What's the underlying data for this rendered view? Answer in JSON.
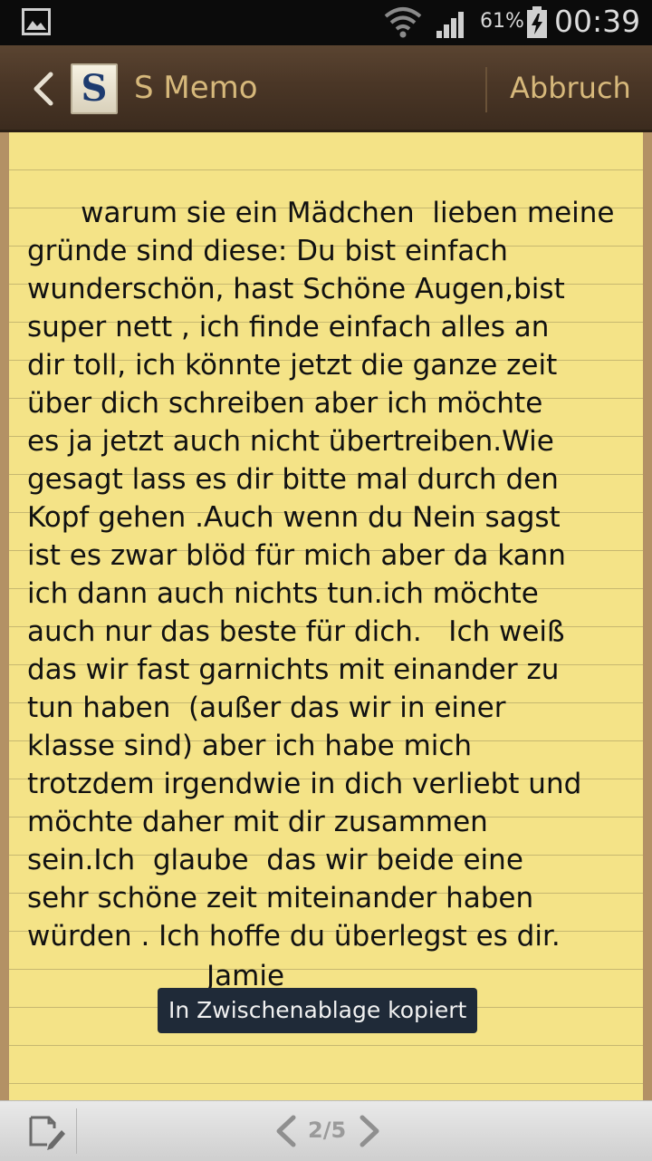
{
  "status_bar": {
    "battery_percent": "61%",
    "clock": "00:39"
  },
  "header": {
    "app_logo_letter": "S",
    "app_title": "S Memo",
    "cancel_label": "Abbruch"
  },
  "memo": {
    "lines": [
      "warum sie ein Mädchen  lieben meine",
      "gründe sind diese: Du bist einfach",
      "wunderschön, hast Schöne Augen,bist",
      "super nett , ich finde einfach alles an",
      "dir toll, ich könnte jetzt die ganze zeit",
      "über dich schreiben aber ich möchte",
      "es ja jetzt auch nicht übertreiben.Wie",
      "gesagt lass es dir bitte mal durch den",
      "Kopf gehen .Auch wenn du Nein sagst",
      "ist es zwar blöd für mich aber da kann",
      "ich dann auch nichts tun.ich möchte",
      "auch nur das beste für dich.   Ich weiß",
      "das wir fast garnichts mit einander zu",
      "tun haben  (außer das wir in einer",
      "klasse sind) aber ich habe mich",
      "trotzdem irgendwie in dich verliebt und",
      "möchte daher mit dir zusammen",
      "sein.Ich  glaube  das wir beide eine",
      "sehr schöne zeit miteinander haben",
      "würden . Ich hoffe du überlegst es dir."
    ],
    "signature": "Jamie"
  },
  "toast": {
    "message": "In Zwischenablage kopiert"
  },
  "bottom_bar": {
    "page_indicator": "2/5"
  },
  "colors": {
    "paper": "#f4e387",
    "header_text": "#d6b87b",
    "toast_bg": "#1f2a38"
  },
  "icons": {
    "status_image": "image-notification-icon",
    "wifi": "wifi-icon",
    "signal": "signal-icon",
    "battery": "battery-charging-icon",
    "back": "chevron-left-icon",
    "edit": "edit-memo-icon",
    "prev": "chevron-left-icon",
    "next": "chevron-right-icon"
  }
}
